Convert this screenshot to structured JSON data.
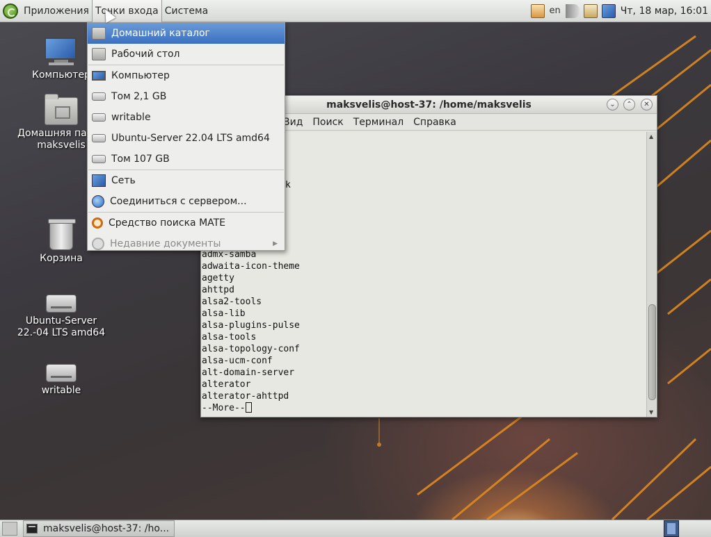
{
  "top_panel": {
    "menus": [
      "Приложения",
      "Точки входа",
      "Система"
    ],
    "language": "en",
    "clock": "Чт, 18 мар, 16:01"
  },
  "places_menu": {
    "items": [
      {
        "label": "Домашний каталог",
        "icon": "home-folder-icon",
        "active": true
      },
      {
        "label": "Рабочий стол",
        "icon": "desktop-folder-icon"
      },
      {
        "label": "Компьютер",
        "icon": "computer-icon"
      },
      {
        "label": "Том 2,1 GB",
        "icon": "drive-icon"
      },
      {
        "label": "writable",
        "icon": "drive-icon"
      },
      {
        "label": "Ubuntu-Server 22.04 LTS amd64",
        "icon": "drive-icon"
      },
      {
        "label": "Том 107 GB",
        "icon": "drive-icon"
      },
      {
        "label": "Сеть",
        "icon": "network-icon"
      },
      {
        "label": "Соединиться с сервером...",
        "icon": "globe-icon"
      },
      {
        "label": "Средство поиска MATE",
        "icon": "search-icon"
      },
      {
        "label": "Недавние документы",
        "icon": "recent-icon",
        "disabled": true
      }
    ]
  },
  "desktop_icons": [
    {
      "label": "Компьютер"
    },
    {
      "label": "Домашняя папка maksvelis"
    },
    {
      "label": "Корзина"
    },
    {
      "label": "Ubuntu-Server 22.-04 LTS amd64"
    },
    {
      "label": "writable"
    }
  ],
  "terminal": {
    "title": "maksvelis@host-37: /home/maksvelis",
    "menu": [
      "Вид",
      "Поиск",
      "Терминал",
      "Справка"
    ],
    "partial_line": "k",
    "lines": [
      "admx-samba",
      "adwaita-icon-theme",
      "agetty",
      "ahttpd",
      "alsa2-tools",
      "alsa-lib",
      "alsa-plugins-pulse",
      "alsa-tools",
      "alsa-topology-conf",
      "alsa-ucm-conf",
      "alt-domain-server",
      "alterator",
      "alterator-ahttpd"
    ],
    "prompt": "--More--"
  },
  "taskbar": {
    "task_label": "maksvelis@host-37: /ho..."
  },
  "colors": {
    "menu_highlight": "#3a70c0",
    "terminal_bg": "#e8e8e2"
  }
}
